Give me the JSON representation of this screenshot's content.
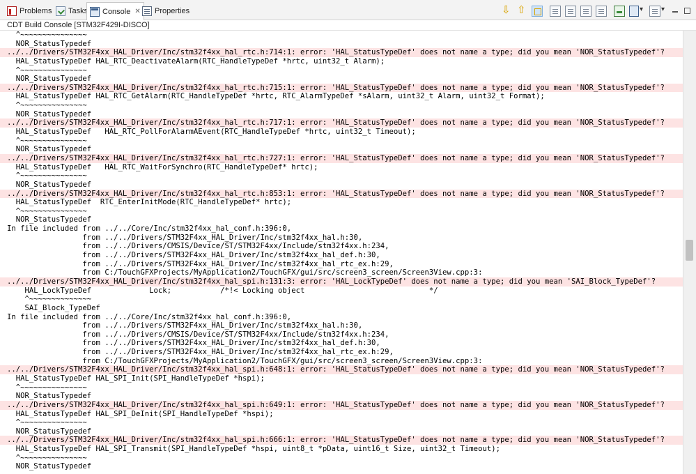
{
  "tabs": [
    {
      "label": "Problems",
      "icon": "problems-icon"
    },
    {
      "label": "Tasks",
      "icon": "tasks-icon"
    },
    {
      "label": "Console",
      "icon": "console-icon",
      "close": "✕"
    },
    {
      "label": "Properties",
      "icon": "properties-icon"
    }
  ],
  "console_title": "CDT Build Console [STM32F429I-DISCO]",
  "colors": {
    "error_bg": "#fde3e3",
    "text": "#000000"
  },
  "lines": [
    {
      "text": "  ^~~~~~~~~~~~~~~~",
      "type": "normal"
    },
    {
      "text": "  NOR_StatusTypedef",
      "type": "normal"
    },
    {
      "text": "../../Drivers/STM32F4xx_HAL_Driver/Inc/stm32f4xx_hal_rtc.h:714:1: error: 'HAL_StatusTypeDef' does not name a type; did you mean 'NOR_StatusTypedef'?",
      "type": "error"
    },
    {
      "text": "  HAL_StatusTypeDef HAL_RTC_DeactivateAlarm(RTC_HandleTypeDef *hrtc, uint32_t Alarm);",
      "type": "normal"
    },
    {
      "text": "  ^~~~~~~~~~~~~~~~",
      "type": "normal"
    },
    {
      "text": "  NOR_StatusTypedef",
      "type": "normal"
    },
    {
      "text": "../../Drivers/STM32F4xx_HAL_Driver/Inc/stm32f4xx_hal_rtc.h:715:1: error: 'HAL_StatusTypeDef' does not name a type; did you mean 'NOR_StatusTypedef'?",
      "type": "error"
    },
    {
      "text": "  HAL_StatusTypeDef HAL_RTC_GetAlarm(RTC_HandleTypeDef *hrtc, RTC_AlarmTypeDef *sAlarm, uint32_t Alarm, uint32_t Format);",
      "type": "normal"
    },
    {
      "text": "  ^~~~~~~~~~~~~~~~",
      "type": "normal"
    },
    {
      "text": "  NOR_StatusTypedef",
      "type": "normal"
    },
    {
      "text": "../../Drivers/STM32F4xx_HAL_Driver/Inc/stm32f4xx_hal_rtc.h:717:1: error: 'HAL_StatusTypeDef' does not name a type; did you mean 'NOR_StatusTypedef'?",
      "type": "error"
    },
    {
      "text": "  HAL_StatusTypeDef   HAL_RTC_PollForAlarmAEvent(RTC_HandleTypeDef *hrtc, uint32_t Timeout);",
      "type": "normal"
    },
    {
      "text": "  ^~~~~~~~~~~~~~~~",
      "type": "normal"
    },
    {
      "text": "  NOR_StatusTypedef",
      "type": "normal"
    },
    {
      "text": "../../Drivers/STM32F4xx_HAL_Driver/Inc/stm32f4xx_hal_rtc.h:727:1: error: 'HAL_StatusTypeDef' does not name a type; did you mean 'NOR_StatusTypedef'?",
      "type": "error"
    },
    {
      "text": "  HAL_StatusTypeDef   HAL_RTC_WaitForSynchro(RTC_HandleTypeDef* hrtc);",
      "type": "normal"
    },
    {
      "text": "  ^~~~~~~~~~~~~~~~",
      "type": "normal"
    },
    {
      "text": "  NOR_StatusTypedef",
      "type": "normal"
    },
    {
      "text": "../../Drivers/STM32F4xx_HAL_Driver/Inc/stm32f4xx_hal_rtc.h:853:1: error: 'HAL_StatusTypeDef' does not name a type; did you mean 'NOR_StatusTypedef'?",
      "type": "error"
    },
    {
      "text": "  HAL_StatusTypeDef  RTC_EnterInitMode(RTC_HandleTypeDef* hrtc);",
      "type": "normal"
    },
    {
      "text": "  ^~~~~~~~~~~~~~~~",
      "type": "normal"
    },
    {
      "text": "  NOR_StatusTypedef",
      "type": "normal"
    },
    {
      "text": "In file included from ../../Core/Inc/stm32f4xx_hal_conf.h:396:0,",
      "type": "normal"
    },
    {
      "text": "                 from ../../Drivers/STM32F4xx_HAL_Driver/Inc/stm32f4xx_hal.h:30,",
      "type": "normal"
    },
    {
      "text": "                 from ../../Drivers/CMSIS/Device/ST/STM32F4xx/Include/stm32f4xx.h:234,",
      "type": "normal"
    },
    {
      "text": "                 from ../../Drivers/STM32F4xx_HAL_Driver/Inc/stm32f4xx_hal_def.h:30,",
      "type": "normal"
    },
    {
      "text": "                 from ../../Drivers/STM32F4xx_HAL_Driver/Inc/stm32f4xx_hal_rtc_ex.h:29,",
      "type": "normal"
    },
    {
      "text": "                 from C:/TouchGFXProjects/MyApplication2/TouchGFX/gui/src/screen3_screen/Screen3View.cpp:3:",
      "type": "normal"
    },
    {
      "text": "../../Drivers/STM32F4xx_HAL_Driver/Inc/stm32f4xx_hal_spi.h:131:3: error: 'HAL_LockTypeDef' does not name a type; did you mean 'SAI_Block_TypeDef'?",
      "type": "error"
    },
    {
      "text": "    HAL_LockTypeDef             Lock;           /*!< Locking object                            */",
      "type": "normal"
    },
    {
      "text": "    ^~~~~~~~~~~~~~~",
      "type": "normal"
    },
    {
      "text": "    SAI_Block_TypeDef",
      "type": "normal"
    },
    {
      "text": "In file included from ../../Core/Inc/stm32f4xx_hal_conf.h:396:0,",
      "type": "normal"
    },
    {
      "text": "                 from ../../Drivers/STM32F4xx_HAL_Driver/Inc/stm32f4xx_hal.h:30,",
      "type": "normal"
    },
    {
      "text": "                 from ../../Drivers/CMSIS/Device/ST/STM32F4xx/Include/stm32f4xx.h:234,",
      "type": "normal"
    },
    {
      "text": "                 from ../../Drivers/STM32F4xx_HAL_Driver/Inc/stm32f4xx_hal_def.h:30,",
      "type": "normal"
    },
    {
      "text": "                 from ../../Drivers/STM32F4xx_HAL_Driver/Inc/stm32f4xx_hal_rtc_ex.h:29,",
      "type": "normal"
    },
    {
      "text": "                 from C:/TouchGFXProjects/MyApplication2/TouchGFX/gui/src/screen3_screen/Screen3View.cpp:3:",
      "type": "normal"
    },
    {
      "text": "../../Drivers/STM32F4xx_HAL_Driver/Inc/stm32f4xx_hal_spi.h:648:1: error: 'HAL_StatusTypeDef' does not name a type; did you mean 'NOR_StatusTypedef'?",
      "type": "error"
    },
    {
      "text": "  HAL_StatusTypeDef HAL_SPI_Init(SPI_HandleTypeDef *hspi);",
      "type": "normal"
    },
    {
      "text": "  ^~~~~~~~~~~~~~~~",
      "type": "normal"
    },
    {
      "text": "  NOR_StatusTypedef",
      "type": "normal"
    },
    {
      "text": "../../Drivers/STM32F4xx_HAL_Driver/Inc/stm32f4xx_hal_spi.h:649:1: error: 'HAL_StatusTypeDef' does not name a type; did you mean 'NOR_StatusTypedef'?",
      "type": "error"
    },
    {
      "text": "  HAL_StatusTypeDef HAL_SPI_DeInit(SPI_HandleTypeDef *hspi);",
      "type": "normal"
    },
    {
      "text": "  ^~~~~~~~~~~~~~~~",
      "type": "normal"
    },
    {
      "text": "  NOR_StatusTypedef",
      "type": "normal"
    },
    {
      "text": "../../Drivers/STM32F4xx_HAL_Driver/Inc/stm32f4xx_hal_spi.h:666:1: error: 'HAL_StatusTypeDef' does not name a type; did you mean 'NOR_StatusTypedef'?",
      "type": "error"
    },
    {
      "text": "  HAL_StatusTypeDef HAL_SPI_Transmit(SPI_HandleTypeDef *hspi, uint8_t *pData, uint16_t Size, uint32_t Timeout);",
      "type": "normal"
    },
    {
      "text": "  ^~~~~~~~~~~~~~~~",
      "type": "normal"
    },
    {
      "text": "  NOR_StatusTypedef",
      "type": "normal"
    }
  ]
}
